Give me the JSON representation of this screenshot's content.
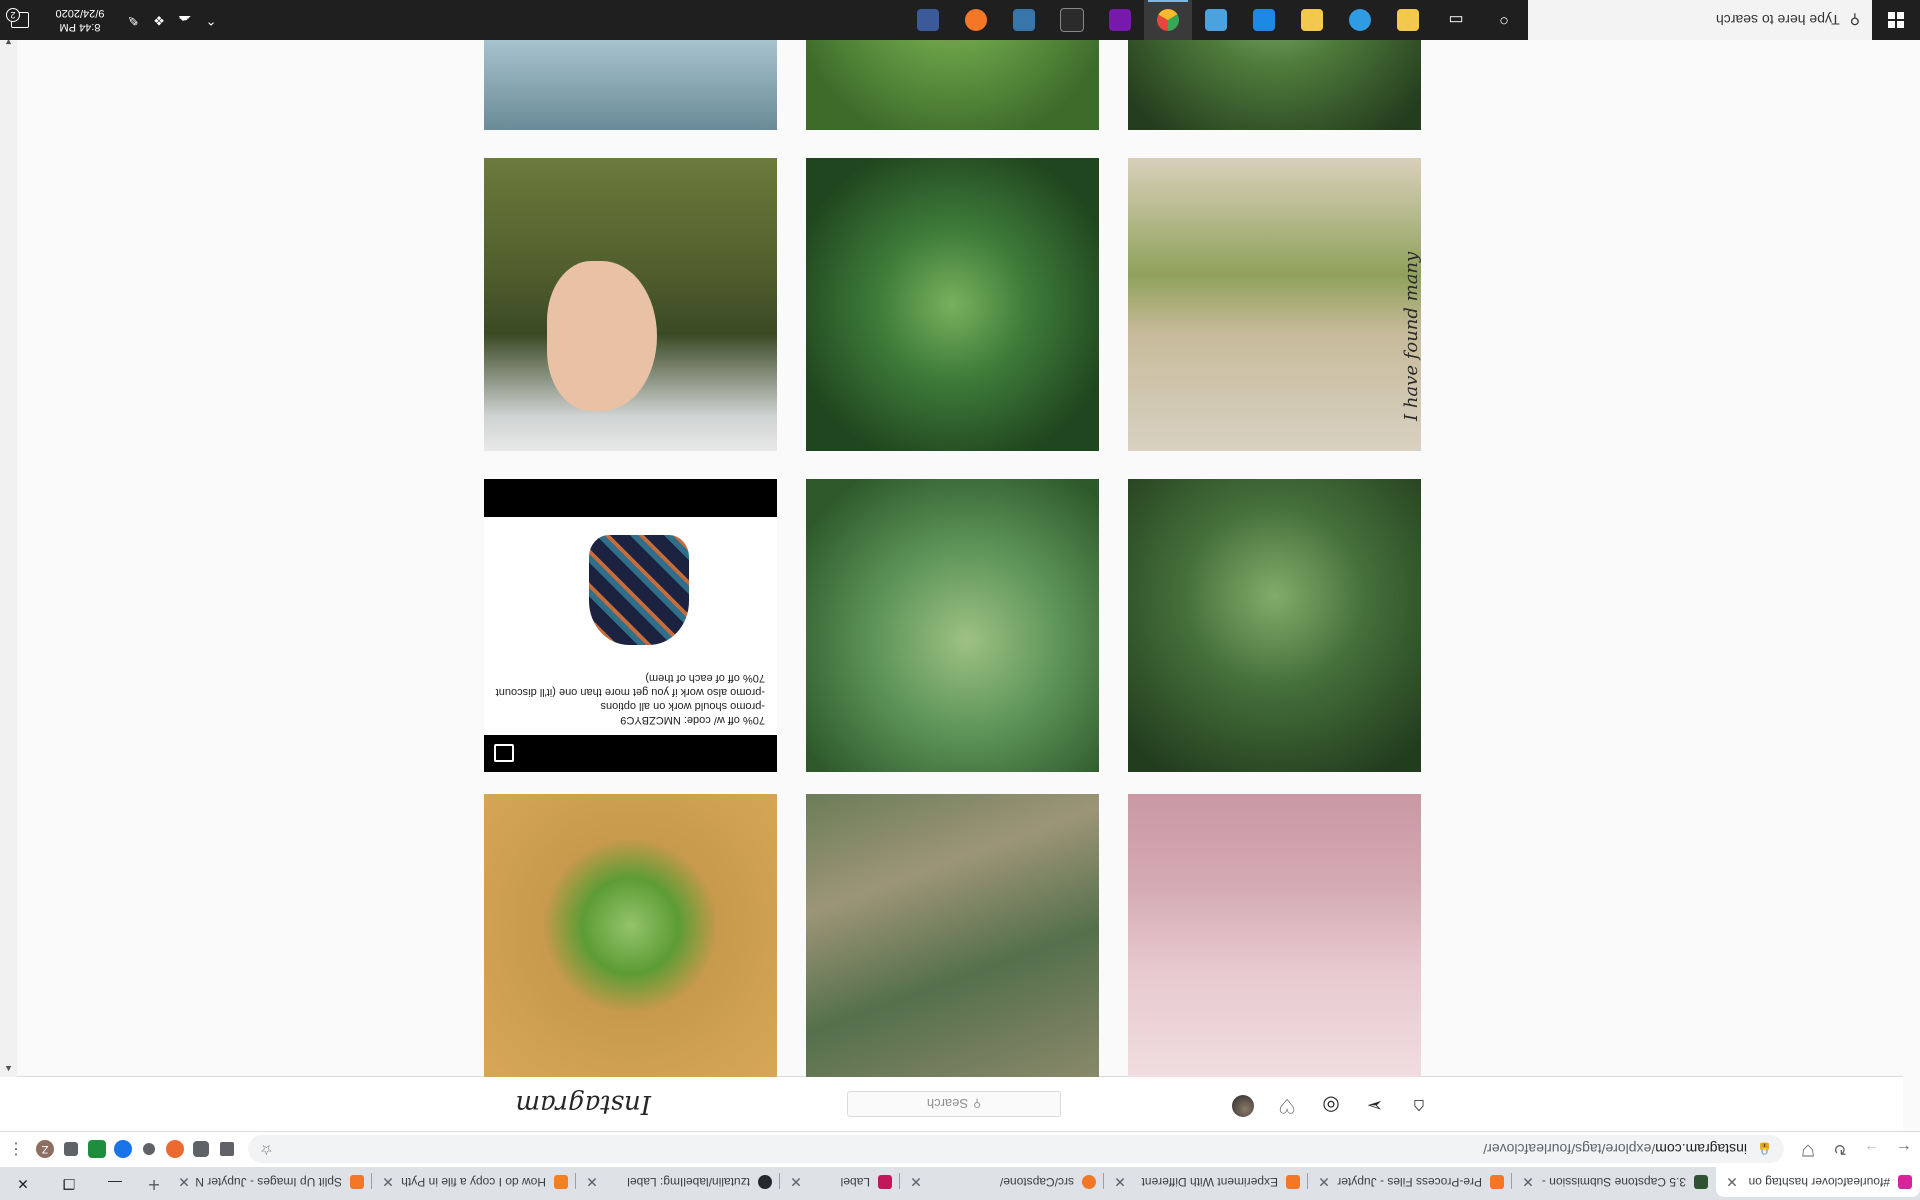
{
  "browser": {
    "tabs": [
      {
        "title": "#fourleafclover hashtag on",
        "favicon_color": "#d6249f",
        "active": true
      },
      {
        "title": "3.5 Capstone Submission -",
        "favicon_color": "#2f5233",
        "active": false
      },
      {
        "title": "Pre-Process Files - Jupyter",
        "favicon_color": "#f37726",
        "active": false
      },
      {
        "title": "Experiment With Different",
        "favicon_color": "#f37726",
        "active": false
      },
      {
        "title": "src/Capstone/",
        "favicon_color": "#f37726",
        "active": false
      },
      {
        "title": "Label",
        "favicon_color": "#c2185b",
        "active": false
      },
      {
        "title": "tzutalin/labelImg: Label",
        "favicon_color": "#24292e",
        "active": false
      },
      {
        "title": "How do I copy a file in Pyth",
        "favicon_color": "#f48024",
        "active": false
      },
      {
        "title": "Split Up Images - Jupyter N",
        "favicon_color": "#f37726",
        "active": false
      }
    ],
    "new_tab_symbol": "+",
    "url_host": "instagram.com",
    "url_path": "/explore/tags/fourleafclover/",
    "extensions": [
      {
        "name": "bookmark-ext",
        "color": "#5f6368"
      },
      {
        "name": "grammarly-ext",
        "color": "#5f6368"
      },
      {
        "name": "octagon-ext",
        "color": "#ec6a2f"
      },
      {
        "name": "circle-ext",
        "color": "#5f6368"
      },
      {
        "name": "word-ext",
        "color": "#1a73e8"
      },
      {
        "name": "money-ext",
        "color": "#1e8e3e"
      },
      {
        "name": "puzzle-ext",
        "color": "#5f6368"
      }
    ],
    "profile_initial": "Z"
  },
  "instagram": {
    "logo": "Instagram",
    "search_placeholder": "Search"
  },
  "posts": [
    {
      "name": "post-tattoo",
      "desc": ""
    },
    {
      "name": "post-clover-dry-grass",
      "desc": ""
    },
    {
      "name": "post-clover-leaf",
      "desc": ""
    },
    {
      "name": "post-clover-grass",
      "desc": ""
    },
    {
      "name": "post-clover-flower",
      "desc": ""
    },
    {
      "name": "post-promo",
      "desc": ""
    },
    {
      "name": "post-craft",
      "desc": ""
    },
    {
      "name": "post-clover-closeup",
      "desc": ""
    },
    {
      "name": "post-hand-grass",
      "desc": ""
    },
    {
      "name": "post-top-plant",
      "desc": ""
    },
    {
      "name": "post-top-flowers",
      "desc": ""
    },
    {
      "name": "post-top-person",
      "desc": ""
    }
  ],
  "promo_text": {
    "line1": "70% off w/ code: NMCZBYC9",
    "line2": "-promo should work on all options",
    "line3": "-promo also work if you get more than one (it'll discount",
    "line4": "70% off of each of them)"
  },
  "craft_script": "I have found many",
  "taskbar": {
    "search_placeholder": "Type here to search",
    "apps": [
      {
        "name": "task-view",
        "color": "#ffffff"
      },
      {
        "name": "store-app",
        "color": "#f2c94c"
      },
      {
        "name": "edge-app",
        "color": "#2f9be3"
      },
      {
        "name": "file-explorer-app",
        "color": "#f2c94c"
      },
      {
        "name": "substance-designer-app",
        "color": "#1e88e5"
      },
      {
        "name": "photos-app",
        "color": "#4aa3df"
      },
      {
        "name": "chrome-app",
        "color": "#e8453c"
      },
      {
        "name": "onenote-app",
        "color": "#7719aa"
      },
      {
        "name": "terminal-app",
        "color": "#2b2b2b"
      },
      {
        "name": "python-app",
        "color": "#3776ab"
      },
      {
        "name": "jupyter-app",
        "color": "#f37726"
      },
      {
        "name": "calculator-app",
        "color": "#3c5a99"
      }
    ],
    "time": "8:44 PM",
    "date": "9/24/2020",
    "notif_count": "2"
  }
}
